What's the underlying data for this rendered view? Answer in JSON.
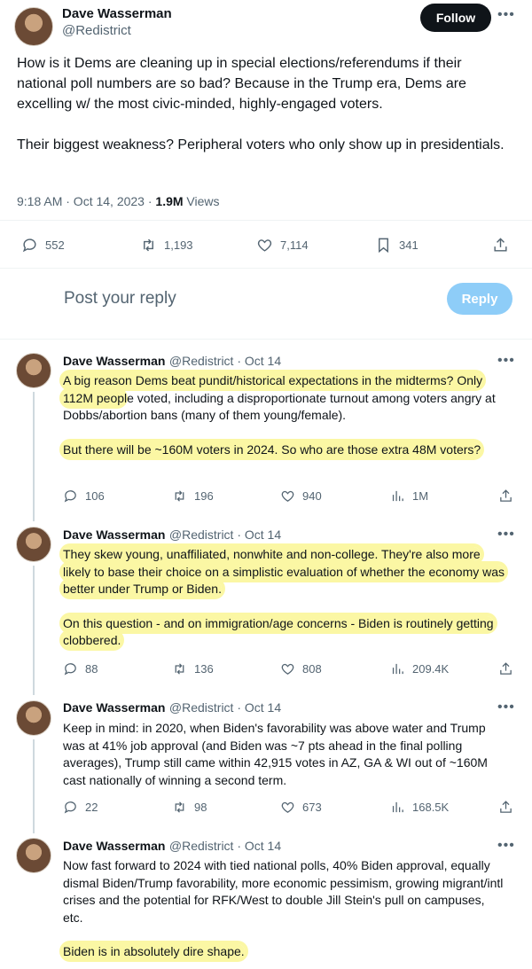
{
  "main_tweet": {
    "author_name": "Dave Wasserman",
    "author_handle": "@Redistrict",
    "follow_label": "Follow",
    "body": "How is it Dems are cleaning up in special elections/referendums if their national poll numbers are so bad? Because in the Trump era, Dems are excelling w/ the most civic-minded, highly-engaged voters.\n\nTheir biggest weakness? Peripheral voters who only show up in presidentials.",
    "time": "9:18 AM · Oct 14, 2023 · ",
    "views_count": "1.9M",
    "views_label": " Views",
    "stats": {
      "replies": "552",
      "reposts": "1,193",
      "likes": "7,114",
      "bookmarks": "341"
    }
  },
  "reply_box": {
    "placeholder": "Post your reply",
    "button_label": "Reply"
  },
  "thread": [
    {
      "name": "Dave Wasserman",
      "handle_date": "@Redistrict · Oct 14",
      "p1_hl": "A big reason Dems beat pundit/historical expectations in the midterms? Only 112M peop",
      "p1_rest": "le voted, including a disproportionate turnout among voters angry at Dobbs/abortion bans (many of them young/female).",
      "p2_hl": "But there will be ~160M voters in 2024. So who are those extra 48M voters?",
      "stats": {
        "replies": "106",
        "reposts": "196",
        "likes": "940",
        "views": "1M"
      }
    },
    {
      "name": "Dave Wasserman",
      "handle_date": "@Redistrict · Oct 14",
      "p1_hl": "They skew young, unaffiliated, nonwhite and non-college. They're also more likely to base their choice on a simplistic evaluation of whether the economy was better under Trump or Biden.",
      "p2_hl": "On this question - and on immigration/age concerns - Biden is routinely getting clobbered.",
      "stats": {
        "replies": "88",
        "reposts": "136",
        "likes": "808",
        "views": "209.4K"
      }
    },
    {
      "name": "Dave Wasserman",
      "handle_date": "@Redistrict · Oct 14",
      "p1": "Keep in mind: in 2020, when Biden's favorability was above water and Trump was at 41% job approval (and Biden was ~7 pts ahead in the final polling averages), Trump still came within 42,915 votes in AZ, GA & WI out of ~160M cast nationally of winning a second term.",
      "stats": {
        "replies": "22",
        "reposts": "98",
        "likes": "673",
        "views": "168.5K"
      }
    },
    {
      "name": "Dave Wasserman",
      "handle_date": "@Redistrict · Oct 14",
      "p1": "Now fast forward to 2024 with tied national polls, 40% Biden approval, equally dismal Biden/Trump favorability, more economic pessimism, growing migrant/intl crises and the potential for RFK/West to double Jill Stein's pull on campuses, etc.",
      "p2_hl": "Biden is in absolutely dire shape."
    }
  ]
}
